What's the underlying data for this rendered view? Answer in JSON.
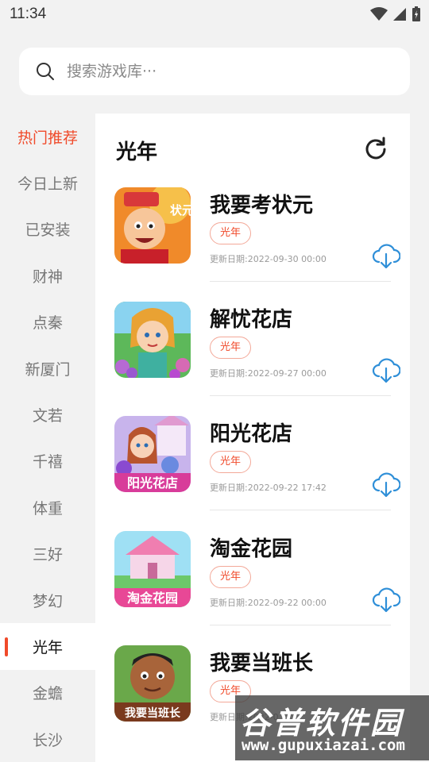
{
  "status_bar": {
    "time": "11:34"
  },
  "search": {
    "placeholder": "搜索游戏库···"
  },
  "sidebar": {
    "items": [
      {
        "label": "热门推荐"
      },
      {
        "label": "今日上新"
      },
      {
        "label": "已安装"
      },
      {
        "label": "财神"
      },
      {
        "label": "点秦"
      },
      {
        "label": "新厦门"
      },
      {
        "label": "文若"
      },
      {
        "label": "千禧"
      },
      {
        "label": "体重"
      },
      {
        "label": "三好"
      },
      {
        "label": "梦幻"
      },
      {
        "label": "光年"
      },
      {
        "label": "金蟾"
      },
      {
        "label": "长沙"
      }
    ],
    "active_index": 11,
    "hot_index": 0
  },
  "panel": {
    "title": "光年"
  },
  "games": [
    {
      "name": "我要考状元",
      "tag": "光年",
      "date": "更新日期:2022-09-30 00:00",
      "thumb_text": "状元"
    },
    {
      "name": "解忧花店",
      "tag": "光年",
      "date": "更新日期:2022-09-27 00:00",
      "thumb_text": ""
    },
    {
      "name": "阳光花店",
      "tag": "光年",
      "date": "更新日期:2022-09-22 17:42",
      "thumb_text": "阳光花店"
    },
    {
      "name": "淘金花园",
      "tag": "光年",
      "date": "更新日期:2022-09-22 00:00",
      "thumb_text": "淘金花园"
    },
    {
      "name": "我要当班长",
      "tag": "光年",
      "date": "更新日期:2022-0",
      "thumb_text": "我要当班长"
    }
  ],
  "watermark": {
    "logo": "谷普软件园",
    "url": "www.gupuxiazai.com"
  },
  "colors": {
    "accent": "#f04a2a",
    "download_icon": "#2f8fd8",
    "tag_border": "#f3a898"
  }
}
